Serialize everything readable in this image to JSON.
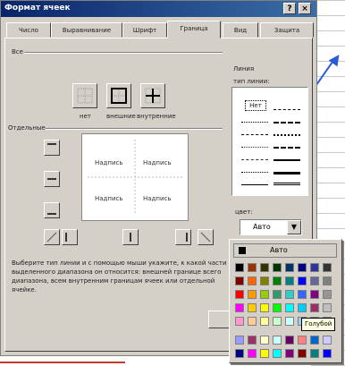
{
  "window": {
    "title": "Формат ячеек",
    "help_btn": "?",
    "close_btn": "×"
  },
  "tabs": [
    {
      "label": "Число"
    },
    {
      "label": "Выравнивание"
    },
    {
      "label": "Шрифт"
    },
    {
      "label": "Граница",
      "active": true
    },
    {
      "label": "Вид"
    },
    {
      "label": "Защита"
    }
  ],
  "all": {
    "group_label": "Все",
    "presets": [
      {
        "label": "нет",
        "icon": "border-none-icon"
      },
      {
        "label": "внешние",
        "icon": "border-outline-icon"
      },
      {
        "label": "внутренние",
        "icon": "border-inside-icon"
      }
    ]
  },
  "separate": {
    "group_label": "Отдельные"
  },
  "preview": {
    "cells": [
      "Надпись",
      "Надпись",
      "Надпись",
      "Надпись"
    ]
  },
  "line": {
    "group_label": "Линия",
    "type_label": "тип линии:",
    "none_label": "Нет",
    "color_label": "цвет:",
    "color_value": "Авто"
  },
  "description": "Выберите тип линии и с помощью мыши укажите, к какой части выделенного диапазона он относится: внешней границе всего диапазона, всем внутренним границам ячеек или отдельной ячейке.",
  "ok_label": "ОК",
  "palette": {
    "auto_label": "Авто",
    "tooltip": "Голубой",
    "colors": [
      [
        "#000000",
        "#993300",
        "#333300",
        "#003300",
        "#003366",
        "#000080",
        "#333399",
        "#333333"
      ],
      [
        "#800000",
        "#FF6600",
        "#808000",
        "#008000",
        "#008080",
        "#0000FF",
        "#666699",
        "#808080"
      ],
      [
        "#FF0000",
        "#FF9900",
        "#99CC00",
        "#339966",
        "#33CCCC",
        "#3366FF",
        "#800080",
        "#969696"
      ],
      [
        "#FF00FF",
        "#FFCC00",
        "#FFFF00",
        "#00FF00",
        "#00FFFF",
        "#00CCFF",
        "#993366",
        "#C0C0C0"
      ],
      [
        "#FF99CC",
        "#FFCC99",
        "#FFFF99",
        "#CCFFCC",
        "#CCFFFF",
        "#99CCFF",
        "#CC99FF",
        "#FFFFFF"
      ],
      [
        "#9999FF",
        "#993366",
        "#FFFFCC",
        "#CCFFFF",
        "#660066",
        "#FF8080",
        "#0066CC",
        "#CCCCFF"
      ],
      [
        "#000080",
        "#FF00FF",
        "#FFFF00",
        "#00FFFF",
        "#800080",
        "#800000",
        "#008080",
        "#0000FF"
      ]
    ]
  }
}
